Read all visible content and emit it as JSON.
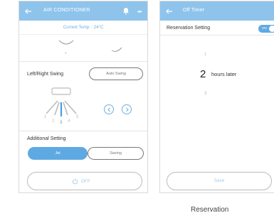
{
  "left_screen": {
    "title": "AIR CONDITIONER",
    "temperature_text": "Current Temp. : 24°C",
    "partial_scroll_label": "s",
    "left_right_swing": {
      "label": "Left/Right Swing",
      "button_label": "Auto Swing",
      "positions": [
        "1",
        "2",
        "3",
        "4",
        "5"
      ],
      "selected_position": "3"
    },
    "additional_setting": {
      "label": "Additional Setting",
      "options": [
        "Jet",
        "Saving"
      ],
      "selected": "Jet"
    },
    "power_button_label": "OFF"
  },
  "right_screen": {
    "title": "Off Timer",
    "reservation_setting": {
      "label": "Reservation Setting",
      "switch_label": "ON"
    },
    "picker": {
      "above": "1",
      "value": "2",
      "unit": "hours later",
      "below": "3"
    },
    "save_button_label": "Save"
  },
  "caption": "Reservation",
  "colors": {
    "header_blue": "#8ec4ec",
    "accent_blue": "#5fa9e3",
    "text_light_blue": "#9fcbee"
  }
}
